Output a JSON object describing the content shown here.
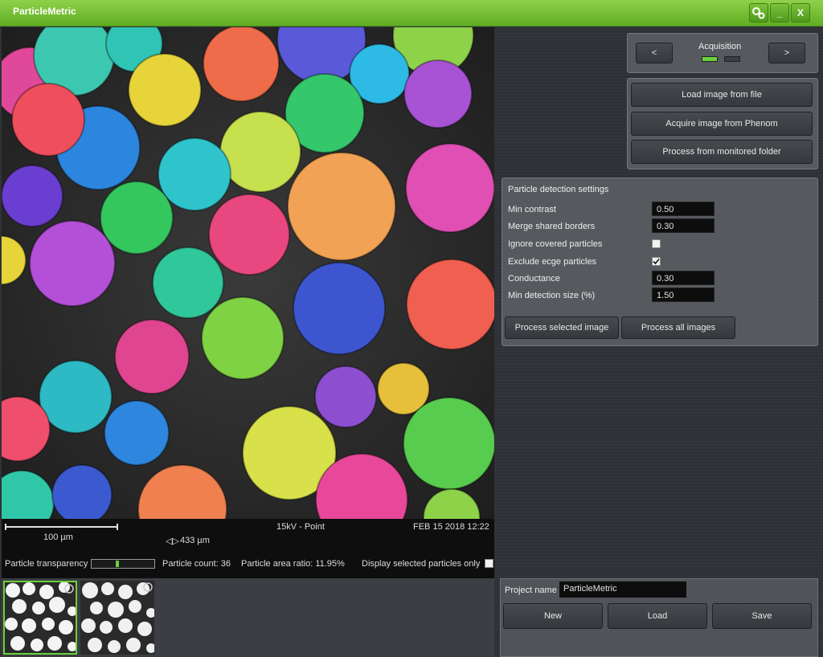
{
  "window": {
    "title": "ParticleMetric"
  },
  "titlebar": {
    "minimize_label": "_",
    "close_label": "X"
  },
  "info": {
    "scale": "100 µm",
    "width_icon": "◁▷",
    "width": "433 µm",
    "voltage_mode": "15kV - Point",
    "datetime": "FEB 15 2018 12:22",
    "transparency_label": "Particle transparency",
    "transparency_level": 0.4,
    "count": "Particle count: 36",
    "area_ratio": "Particle area ratio: 11.95%",
    "display_selected": "Display selected particles only",
    "display_selected_checked": false
  },
  "acquisition": {
    "title": "Acquisition",
    "prev_label": "<",
    "next_label": ">"
  },
  "sources": {
    "load_file": "Load image from file",
    "acquire_phenom": "Acquire image from Phenom",
    "process_folder": "Process from monitored folder"
  },
  "detection": {
    "title": "Particle detection settings",
    "min_contrast_label": "Min contrast",
    "min_contrast": "0.50",
    "merge_label": "Merge shared borders",
    "merge": "0.30",
    "ignore_label": "Ignore covered particles",
    "ignore_checked": false,
    "exclude_label": "Exclude ecge particles",
    "exclude_checked": true,
    "conductance_label": "Conductance",
    "conductance": "0.30",
    "min_size_label": "Min detection size (%)",
    "min_size": "1.50",
    "process_selected": "Process selected image",
    "process_all": "Process all images"
  },
  "project": {
    "name_label": "Project name",
    "name": "ParticleMetric",
    "new_label": "New",
    "load_label": "Load",
    "save_label": "Save"
  },
  "colors": {
    "accent": "#6ad13b",
    "titlebar": "#6fbf2e"
  }
}
